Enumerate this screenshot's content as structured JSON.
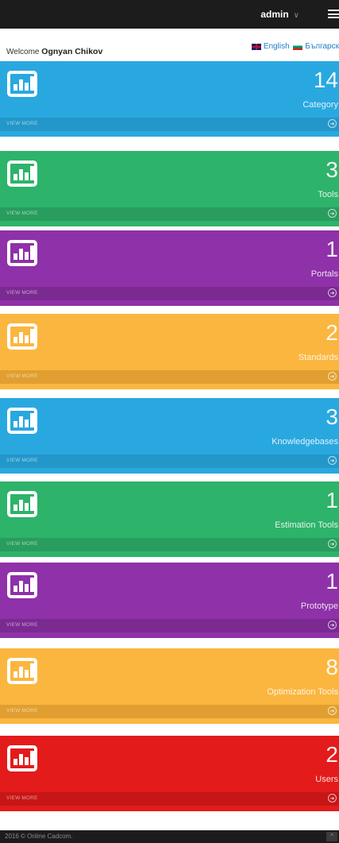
{
  "header": {
    "user_label": "admin",
    "chevron": "∨",
    "menu_icon": "hamburger-icon"
  },
  "welcome": {
    "prefix": "Welcome",
    "name": "Ognyan Chikov"
  },
  "languages": [
    {
      "label": "English",
      "flag": "uk-flag-icon"
    },
    {
      "label": "Българск",
      "flag": "bg-flag-icon"
    }
  ],
  "cards": [
    {
      "count": "14",
      "label": "Category",
      "link": "VIEW MORE",
      "color": "#29a8e0",
      "footer_color": "#2397c9",
      "icon": "bar-chart-icon"
    },
    {
      "count": "3",
      "label": "Tools",
      "link": "VIEW MORE",
      "color": "#2eb36a",
      "footer_color": "#289d5d",
      "icon": "bar-chart-icon"
    },
    {
      "count": "1",
      "label": "Portals",
      "link": "VIEW MORE",
      "color": "#8f31a8",
      "footer_color": "#7b2a91",
      "icon": "bar-chart-icon"
    },
    {
      "count": "2",
      "label": "Standards",
      "link": "VIEW MORE",
      "color": "#fbb63f",
      "footer_color": "#e09f30",
      "icon": "bar-chart-icon"
    },
    {
      "count": "3",
      "label": "Knowledgebases",
      "link": "VIEW MORE",
      "color": "#29a8e0",
      "footer_color": "#2397c9",
      "icon": "bar-chart-icon"
    },
    {
      "count": "1",
      "label": "Estimation Tools",
      "link": "VIEW MORE",
      "color": "#2eb36a",
      "footer_color": "#289d5d",
      "icon": "bar-chart-icon"
    },
    {
      "count": "1",
      "label": "Prototype",
      "link": "VIEW MORE",
      "color": "#8f31a8",
      "footer_color": "#7b2a91",
      "icon": "bar-chart-icon"
    },
    {
      "count": "8",
      "label": "Optimization Tools",
      "link": "VIEW MORE",
      "color": "#fbb63f",
      "footer_color": "#e09f30",
      "icon": "bar-chart-icon"
    },
    {
      "count": "2",
      "label": "Users",
      "link": "VIEW MORE",
      "color": "#e31b1b",
      "footer_color": "#c71616",
      "icon": "bar-chart-icon"
    }
  ],
  "footer": {
    "copyright": "2016 © Online Cadcom.",
    "scroll_top_icon": "chevron-up-icon"
  }
}
